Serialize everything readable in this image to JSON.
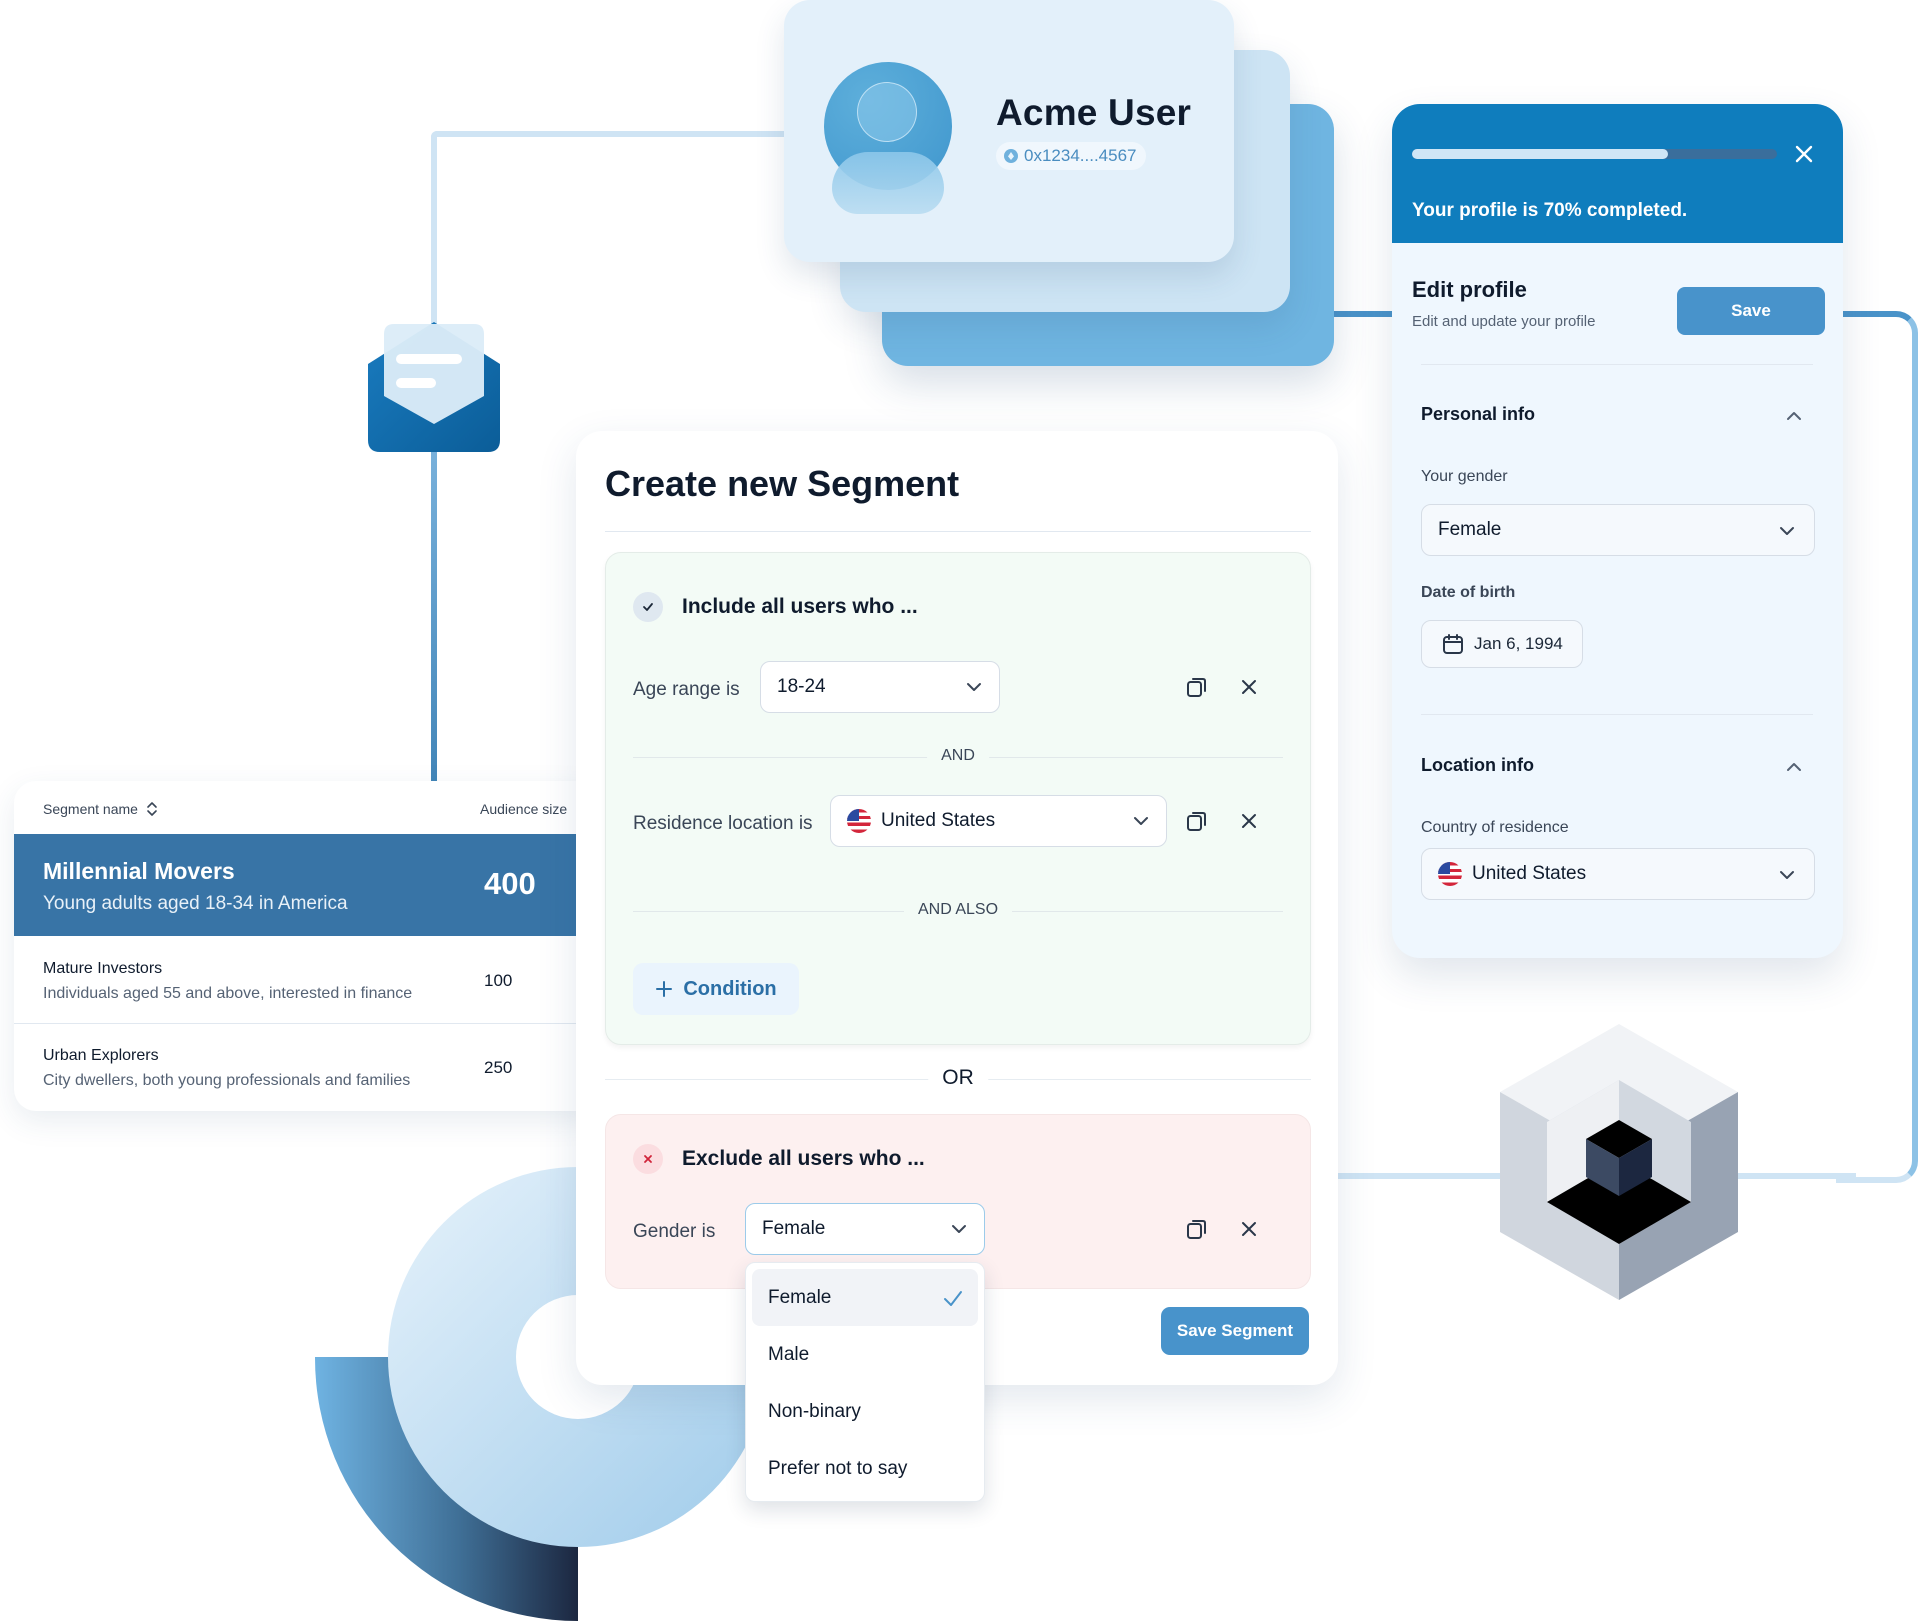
{
  "user_card": {
    "name": "Acme User",
    "wallet_address": "0x1234....4567",
    "avatar_icon": "user-avatar-icon",
    "wallet_icon": "ethereum-icon"
  },
  "profile_panel": {
    "progress_percent": 70,
    "progress_message": "Your profile is 70% completed.",
    "close_icon": "close-icon",
    "title": "Edit profile",
    "subtitle": "Edit and update your profile",
    "save_label": "Save",
    "personal_section": {
      "title": "Personal info",
      "expanded": true,
      "gender_label": "Your gender",
      "gender_value": "Female",
      "dob_label": "Date of birth",
      "dob_value": "Jan 6, 1994"
    },
    "location_section": {
      "title": "Location info",
      "expanded": true,
      "country_label": "Country of residence",
      "country_value": "United States"
    }
  },
  "segment_table": {
    "columns": [
      "Segment name",
      "Audience size"
    ],
    "rows": [
      {
        "name": "Millennial Movers",
        "description": "Young adults aged 18-34 in America",
        "size": "400",
        "selected": true
      },
      {
        "name": "Mature Investors",
        "description": "Individuals aged 55 and above, interested in finance",
        "size": "100",
        "selected": false
      },
      {
        "name": "Urban Explorers",
        "description": "City dwellers, both young professionals and families",
        "size": "250",
        "selected": false
      }
    ]
  },
  "segment_builder": {
    "title": "Create new Segment",
    "include_group": {
      "title": "Include all users who ...",
      "conditions": [
        {
          "label": "Age range is",
          "value": "18-24"
        },
        {
          "label": "Residence location is",
          "value": "United States"
        }
      ],
      "and_label": "AND",
      "and_also_label": "AND ALSO",
      "add_condition_label": "Condition"
    },
    "or_label": "OR",
    "exclude_group": {
      "title": "Exclude all users who ...",
      "conditions": [
        {
          "label": "Gender is",
          "value": "Female"
        }
      ]
    },
    "gender_dropdown": {
      "open": true,
      "options": [
        "Female",
        "Male",
        "Non-binary",
        "Prefer not to say"
      ],
      "selected": "Female"
    },
    "save_label": "Save Segment"
  },
  "colors": {
    "primary": "#4893cb",
    "header_blue": "#0f7dbd",
    "row_highlight": "#3874a6",
    "include_bg": "#f3fbf6",
    "exclude_bg": "#fdf0f0",
    "exclude_icon": "#d0243a",
    "text_dark": "#0f1b2d"
  }
}
